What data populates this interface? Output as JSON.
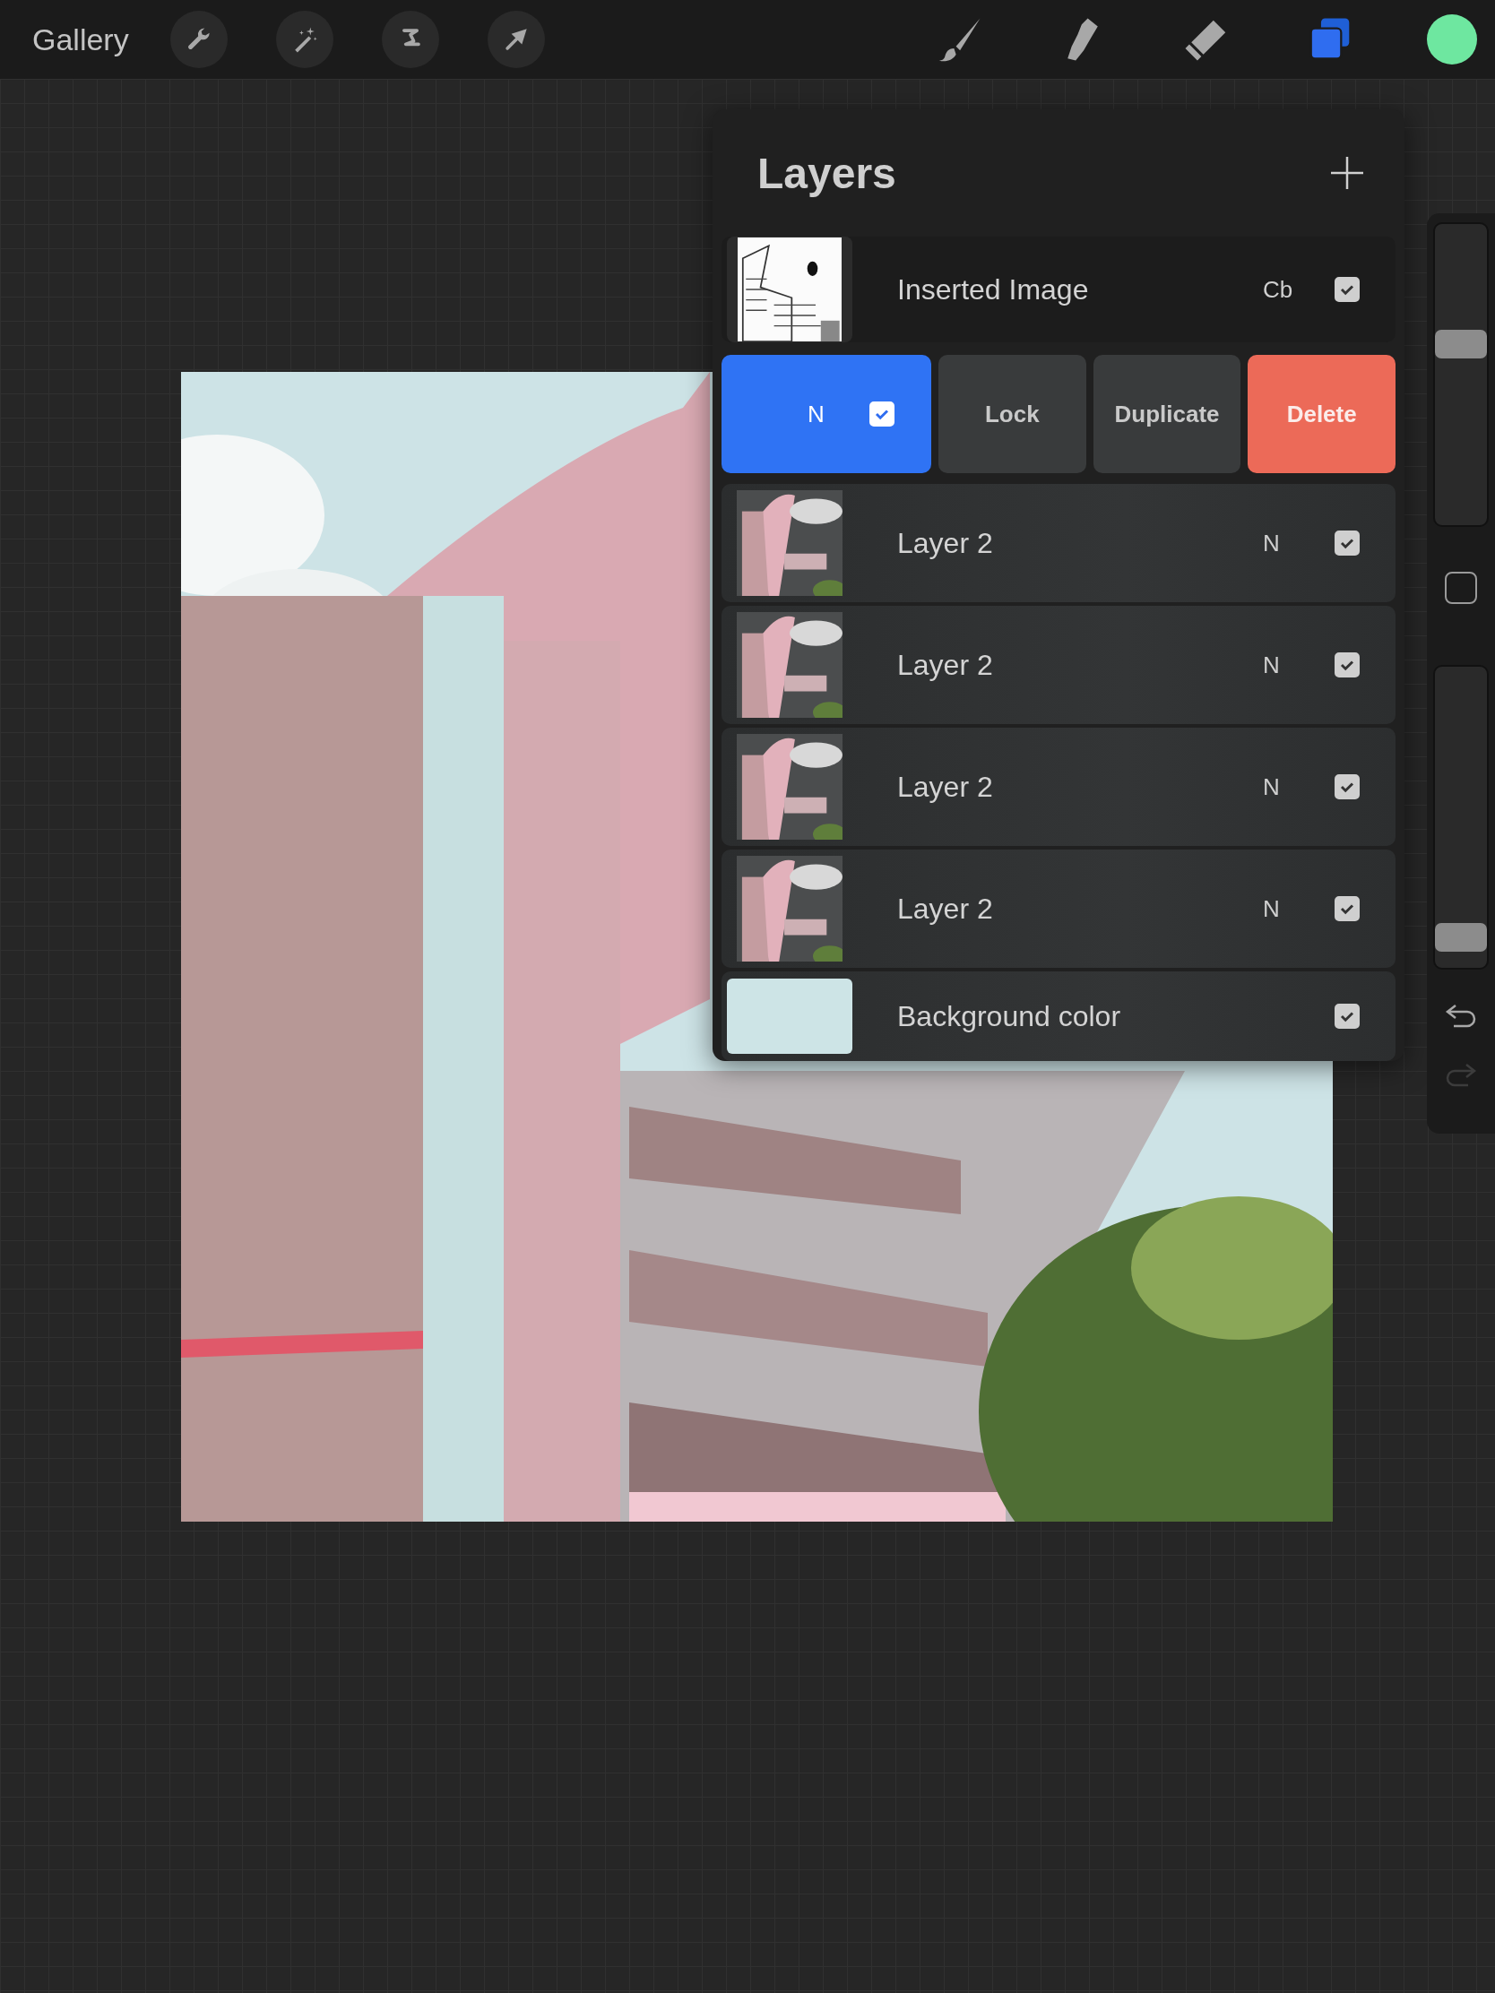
{
  "toolbar": {
    "gallery": "Gallery",
    "tools": [
      {
        "kind": "brush",
        "selected": false
      },
      {
        "kind": "smudge",
        "selected": false
      },
      {
        "kind": "eraser",
        "selected": false
      },
      {
        "kind": "layers",
        "selected": true
      }
    ]
  },
  "layers_panel": {
    "title": "Layers",
    "layers": [
      {
        "name": "Inserted Image",
        "blend": "Cb",
        "visible": true,
        "selected": false
      },
      {
        "kind": "swiped",
        "blend": "N",
        "visible": true,
        "selected": true,
        "actions": [
          {
            "label": "Lock",
            "kind": "normal"
          },
          {
            "label": "Duplicate",
            "kind": "normal"
          },
          {
            "label": "Delete",
            "kind": "destructive"
          }
        ]
      },
      {
        "kind": "layer",
        "name": "Layer 2",
        "blend": "N",
        "visible": true,
        "selected": false
      },
      {
        "kind": "layer",
        "name": "Layer 2",
        "blend": "N",
        "visible": true,
        "selected": false
      },
      {
        "kind": "layer",
        "name": "Layer 2",
        "blend": "N",
        "visible": true,
        "selected": false
      },
      {
        "kind": "layer",
        "name": "Layer 2",
        "blend": "N",
        "visible": true,
        "selected": false
      },
      {
        "kind": "background",
        "name": "Background color",
        "visible": true,
        "selected": false,
        "color": "#cde4e6"
      }
    ]
  },
  "sidebar": {
    "brush_size": {
      "level": 0.6
    },
    "opacity": {
      "level": 0.1
    },
    "undo": {
      "disabled": false
    },
    "redo": {
      "disabled": true
    }
  }
}
